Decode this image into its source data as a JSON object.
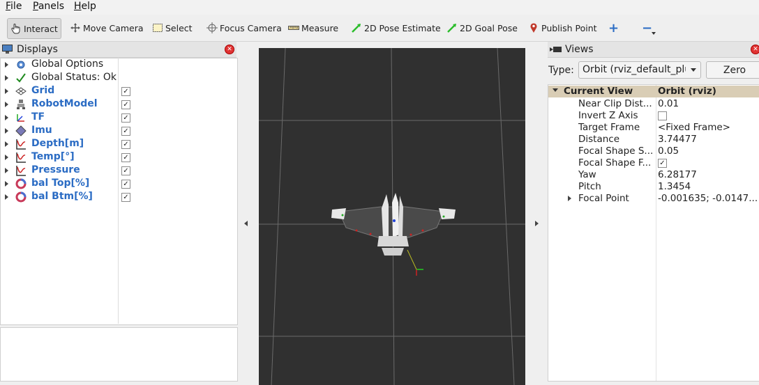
{
  "menu": [
    {
      "label": "File",
      "ul": "F",
      "rest": "ile"
    },
    {
      "label": "Panels",
      "ul": "P",
      "rest": "anels"
    },
    {
      "label": "Help",
      "ul": "H",
      "rest": "elp"
    }
  ],
  "toolbar": {
    "interact": "Interact",
    "move_camera": "Move Camera",
    "select": "Select",
    "focus_camera": "Focus Camera",
    "measure": "Measure",
    "pose_estimate": "2D Pose Estimate",
    "goal_pose": "2D Goal Pose",
    "publish_point": "Publish Point",
    "add_symbol": "+",
    "remove_symbol": "−"
  },
  "displays": {
    "title": "Displays",
    "items": [
      {
        "label": "Global Options",
        "icon": "gear-icon",
        "checked": null,
        "blue": false
      },
      {
        "label": "Global Status: Ok",
        "icon": "checkmark-icon",
        "checked": null,
        "blue": false
      },
      {
        "label": "Grid",
        "icon": "grid-icon",
        "checked": true,
        "blue": true
      },
      {
        "label": "RobotModel",
        "icon": "robot-icon",
        "checked": true,
        "blue": true
      },
      {
        "label": "TF",
        "icon": "axes-icon",
        "checked": true,
        "blue": true
      },
      {
        "label": "Imu",
        "icon": "diamond-icon",
        "checked": true,
        "blue": true
      },
      {
        "label": "Depth[m]",
        "icon": "plot-icon",
        "checked": true,
        "blue": true
      },
      {
        "label": "Temp[°]",
        "icon": "plot-icon",
        "checked": true,
        "blue": true
      },
      {
        "label": "Pressure",
        "icon": "plot-icon",
        "checked": true,
        "blue": true
      },
      {
        "label": "bal Top[%]",
        "icon": "ring-icon",
        "checked": true,
        "blue": true
      },
      {
        "label": "bal Btm[%]",
        "icon": "ring-icon",
        "checked": true,
        "blue": true
      }
    ]
  },
  "views": {
    "title": "Views",
    "type_label": "Type:",
    "type_value": "Orbit (rviz_default_plu",
    "zero_label": "Zero",
    "header_key": "Current View",
    "header_value": "Orbit (rviz)",
    "props": [
      {
        "key": "Near Clip Dist...",
        "value": "0.01"
      },
      {
        "key": "Invert Z Axis",
        "value": "",
        "checkbox": false
      },
      {
        "key": "Target Frame",
        "value": "<Fixed Frame>"
      },
      {
        "key": "Distance",
        "value": "3.74477"
      },
      {
        "key": "Focal Shape S...",
        "value": "0.05"
      },
      {
        "key": "Focal Shape F...",
        "value": "",
        "checkbox": true
      },
      {
        "key": "Yaw",
        "value": "6.28177"
      },
      {
        "key": "Pitch",
        "value": "1.3454"
      },
      {
        "key": "Focal Point",
        "value": "-0.001635; -0.0147..."
      }
    ]
  },
  "colors": {
    "accent_blue": "#2b6cc4",
    "viewport_bg": "#303030",
    "close_red": "#e03333"
  }
}
